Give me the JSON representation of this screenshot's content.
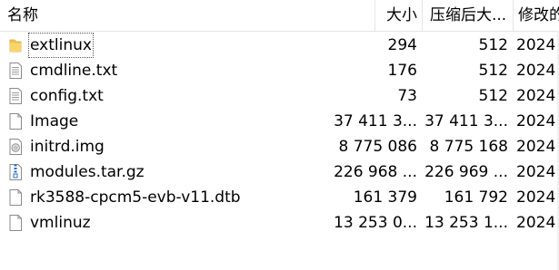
{
  "columns": {
    "name": "名称",
    "size": "大小",
    "compressed": "压缩后大...",
    "modified": "修改的"
  },
  "files": [
    {
      "name": "extlinux",
      "size": "294",
      "compressed": "512",
      "modified": "2024",
      "icon": "folder-icon"
    },
    {
      "name": "cmdline.txt",
      "size": "176",
      "compressed": "512",
      "modified": "2024",
      "icon": "text-file-icon"
    },
    {
      "name": "config.txt",
      "size": "73",
      "compressed": "512",
      "modified": "2024",
      "icon": "text-file-icon"
    },
    {
      "name": "Image",
      "size": "37 411 3...",
      "compressed": "37 411 3...",
      "modified": "2024",
      "icon": "blank-file-icon"
    },
    {
      "name": "initrd.img",
      "size": "8 775 086",
      "compressed": "8 775 168",
      "modified": "2024",
      "icon": "disc-image-icon"
    },
    {
      "name": "modules.tar.gz",
      "size": "226 968 ...",
      "compressed": "226 969 ...",
      "modified": "2024",
      "icon": "archive-file-icon"
    },
    {
      "name": "rk3588-cpcm5-evb-v11.dtb",
      "size": "161 379",
      "compressed": "161 792",
      "modified": "2024",
      "icon": "blank-file-icon"
    },
    {
      "name": "vmlinuz",
      "size": "13 253 0...",
      "compressed": "13 253 1...",
      "modified": "2024",
      "icon": "blank-file-icon"
    }
  ],
  "colors": {
    "folder": "#f3c44a",
    "file_border": "#8a8a8a",
    "archive_accent": "#2b6cc4"
  }
}
